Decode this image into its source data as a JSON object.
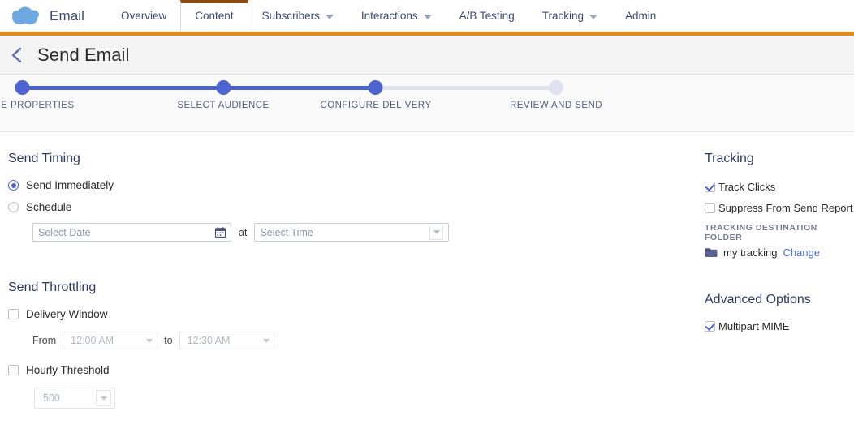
{
  "header": {
    "brand_name": "Email",
    "logo_icon": "salesforce-cloud-icon",
    "tabs": [
      {
        "label": "Overview",
        "has_caret": false,
        "active": false
      },
      {
        "label": "Content",
        "has_caret": false,
        "active": true
      },
      {
        "label": "Subscribers",
        "has_caret": true,
        "active": false
      },
      {
        "label": "Interactions",
        "has_caret": true,
        "active": false
      },
      {
        "label": "A/B Testing",
        "has_caret": false,
        "active": false
      },
      {
        "label": "Tracking",
        "has_caret": true,
        "active": false
      },
      {
        "label": "Admin",
        "has_caret": false,
        "active": false
      }
    ]
  },
  "titlebar": {
    "back_icon": "back-chevron-icon",
    "title": "Send Email"
  },
  "wizard": {
    "steps": [
      {
        "label": "DEFINE PROPERTIES",
        "state": "complete"
      },
      {
        "label": "SELECT AUDIENCE",
        "state": "complete"
      },
      {
        "label": "CONFIGURE DELIVERY",
        "state": "current"
      },
      {
        "label": "REVIEW AND SEND",
        "state": "upcoming"
      }
    ],
    "active_color": "#4c63d2",
    "inactive_color": "#e0e3ef"
  },
  "send_timing": {
    "title": "Send Timing",
    "options": [
      {
        "label": "Send Immediately",
        "selected": true
      },
      {
        "label": "Schedule",
        "selected": false
      }
    ],
    "date_field": {
      "placeholder": "Select Date",
      "value": "",
      "icon": "calendar-icon"
    },
    "at_label": "at",
    "time_field": {
      "placeholder": "Select Time",
      "value": "",
      "icon": "chevron-down-icon"
    }
  },
  "send_throttling": {
    "title": "Send Throttling",
    "delivery_window": {
      "label": "Delivery Window",
      "checked": false,
      "from_label": "From",
      "from_value": "12:00 AM",
      "to_label": "to",
      "to_value": "12:30 AM"
    },
    "hourly_threshold": {
      "label": "Hourly Threshold",
      "checked": false,
      "value": "500"
    }
  },
  "tracking": {
    "title": "Tracking",
    "checkboxes": [
      {
        "label": "Track Clicks",
        "checked": true
      },
      {
        "label": "Suppress From Send Report",
        "checked": false
      }
    ],
    "folder_label": "TRACKING DESTINATION FOLDER",
    "folder_icon": "folder-icon",
    "folder_name": "my tracking",
    "change_link": "Change"
  },
  "advanced_options": {
    "title": "Advanced Options",
    "checkboxes": [
      {
        "label": "Multipart MIME",
        "checked": true
      }
    ]
  },
  "colors": {
    "accent_orange": "#e08d24",
    "active_tab_top": "#8a4b0c",
    "primary_blue": "#4c63d2",
    "link_blue": "#4a6ee0",
    "heading_navy": "#2e3a63",
    "cloud_blue": "#6ca9e0"
  }
}
